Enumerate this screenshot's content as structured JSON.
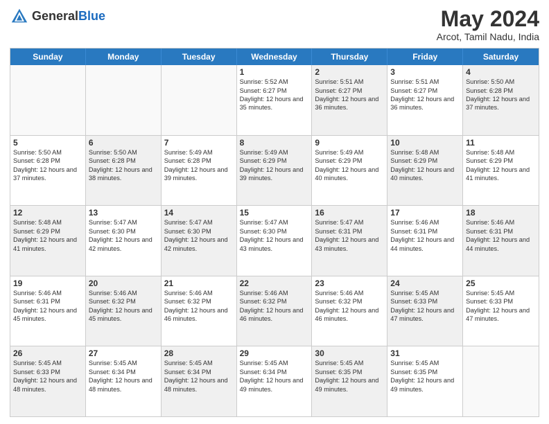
{
  "header": {
    "logo_general": "General",
    "logo_blue": "Blue",
    "month_title": "May 2024",
    "location": "Arcot, Tamil Nadu, India"
  },
  "weekdays": [
    "Sunday",
    "Monday",
    "Tuesday",
    "Wednesday",
    "Thursday",
    "Friday",
    "Saturday"
  ],
  "rows": [
    [
      {
        "day": "",
        "sunrise": "",
        "sunset": "",
        "daylight": "",
        "shaded": false,
        "empty": true
      },
      {
        "day": "",
        "sunrise": "",
        "sunset": "",
        "daylight": "",
        "shaded": false,
        "empty": true
      },
      {
        "day": "",
        "sunrise": "",
        "sunset": "",
        "daylight": "",
        "shaded": false,
        "empty": true
      },
      {
        "day": "1",
        "sunrise": "Sunrise: 5:52 AM",
        "sunset": "Sunset: 6:27 PM",
        "daylight": "Daylight: 12 hours and 35 minutes.",
        "shaded": false,
        "empty": false
      },
      {
        "day": "2",
        "sunrise": "Sunrise: 5:51 AM",
        "sunset": "Sunset: 6:27 PM",
        "daylight": "Daylight: 12 hours and 36 minutes.",
        "shaded": true,
        "empty": false
      },
      {
        "day": "3",
        "sunrise": "Sunrise: 5:51 AM",
        "sunset": "Sunset: 6:27 PM",
        "daylight": "Daylight: 12 hours and 36 minutes.",
        "shaded": false,
        "empty": false
      },
      {
        "day": "4",
        "sunrise": "Sunrise: 5:50 AM",
        "sunset": "Sunset: 6:28 PM",
        "daylight": "Daylight: 12 hours and 37 minutes.",
        "shaded": true,
        "empty": false
      }
    ],
    [
      {
        "day": "5",
        "sunrise": "Sunrise: 5:50 AM",
        "sunset": "Sunset: 6:28 PM",
        "daylight": "Daylight: 12 hours and 37 minutes.",
        "shaded": false,
        "empty": false
      },
      {
        "day": "6",
        "sunrise": "Sunrise: 5:50 AM",
        "sunset": "Sunset: 6:28 PM",
        "daylight": "Daylight: 12 hours and 38 minutes.",
        "shaded": true,
        "empty": false
      },
      {
        "day": "7",
        "sunrise": "Sunrise: 5:49 AM",
        "sunset": "Sunset: 6:28 PM",
        "daylight": "Daylight: 12 hours and 39 minutes.",
        "shaded": false,
        "empty": false
      },
      {
        "day": "8",
        "sunrise": "Sunrise: 5:49 AM",
        "sunset": "Sunset: 6:29 PM",
        "daylight": "Daylight: 12 hours and 39 minutes.",
        "shaded": true,
        "empty": false
      },
      {
        "day": "9",
        "sunrise": "Sunrise: 5:49 AM",
        "sunset": "Sunset: 6:29 PM",
        "daylight": "Daylight: 12 hours and 40 minutes.",
        "shaded": false,
        "empty": false
      },
      {
        "day": "10",
        "sunrise": "Sunrise: 5:48 AM",
        "sunset": "Sunset: 6:29 PM",
        "daylight": "Daylight: 12 hours and 40 minutes.",
        "shaded": true,
        "empty": false
      },
      {
        "day": "11",
        "sunrise": "Sunrise: 5:48 AM",
        "sunset": "Sunset: 6:29 PM",
        "daylight": "Daylight: 12 hours and 41 minutes.",
        "shaded": false,
        "empty": false
      }
    ],
    [
      {
        "day": "12",
        "sunrise": "Sunrise: 5:48 AM",
        "sunset": "Sunset: 6:29 PM",
        "daylight": "Daylight: 12 hours and 41 minutes.",
        "shaded": true,
        "empty": false
      },
      {
        "day": "13",
        "sunrise": "Sunrise: 5:47 AM",
        "sunset": "Sunset: 6:30 PM",
        "daylight": "Daylight: 12 hours and 42 minutes.",
        "shaded": false,
        "empty": false
      },
      {
        "day": "14",
        "sunrise": "Sunrise: 5:47 AM",
        "sunset": "Sunset: 6:30 PM",
        "daylight": "Daylight: 12 hours and 42 minutes.",
        "shaded": true,
        "empty": false
      },
      {
        "day": "15",
        "sunrise": "Sunrise: 5:47 AM",
        "sunset": "Sunset: 6:30 PM",
        "daylight": "Daylight: 12 hours and 43 minutes.",
        "shaded": false,
        "empty": false
      },
      {
        "day": "16",
        "sunrise": "Sunrise: 5:47 AM",
        "sunset": "Sunset: 6:31 PM",
        "daylight": "Daylight: 12 hours and 43 minutes.",
        "shaded": true,
        "empty": false
      },
      {
        "day": "17",
        "sunrise": "Sunrise: 5:46 AM",
        "sunset": "Sunset: 6:31 PM",
        "daylight": "Daylight: 12 hours and 44 minutes.",
        "shaded": false,
        "empty": false
      },
      {
        "day": "18",
        "sunrise": "Sunrise: 5:46 AM",
        "sunset": "Sunset: 6:31 PM",
        "daylight": "Daylight: 12 hours and 44 minutes.",
        "shaded": true,
        "empty": false
      }
    ],
    [
      {
        "day": "19",
        "sunrise": "Sunrise: 5:46 AM",
        "sunset": "Sunset: 6:31 PM",
        "daylight": "Daylight: 12 hours and 45 minutes.",
        "shaded": false,
        "empty": false
      },
      {
        "day": "20",
        "sunrise": "Sunrise: 5:46 AM",
        "sunset": "Sunset: 6:32 PM",
        "daylight": "Daylight: 12 hours and 45 minutes.",
        "shaded": true,
        "empty": false
      },
      {
        "day": "21",
        "sunrise": "Sunrise: 5:46 AM",
        "sunset": "Sunset: 6:32 PM",
        "daylight": "Daylight: 12 hours and 46 minutes.",
        "shaded": false,
        "empty": false
      },
      {
        "day": "22",
        "sunrise": "Sunrise: 5:46 AM",
        "sunset": "Sunset: 6:32 PM",
        "daylight": "Daylight: 12 hours and 46 minutes.",
        "shaded": true,
        "empty": false
      },
      {
        "day": "23",
        "sunrise": "Sunrise: 5:46 AM",
        "sunset": "Sunset: 6:32 PM",
        "daylight": "Daylight: 12 hours and 46 minutes.",
        "shaded": false,
        "empty": false
      },
      {
        "day": "24",
        "sunrise": "Sunrise: 5:45 AM",
        "sunset": "Sunset: 6:33 PM",
        "daylight": "Daylight: 12 hours and 47 minutes.",
        "shaded": true,
        "empty": false
      },
      {
        "day": "25",
        "sunrise": "Sunrise: 5:45 AM",
        "sunset": "Sunset: 6:33 PM",
        "daylight": "Daylight: 12 hours and 47 minutes.",
        "shaded": false,
        "empty": false
      }
    ],
    [
      {
        "day": "26",
        "sunrise": "Sunrise: 5:45 AM",
        "sunset": "Sunset: 6:33 PM",
        "daylight": "Daylight: 12 hours and 48 minutes.",
        "shaded": true,
        "empty": false
      },
      {
        "day": "27",
        "sunrise": "Sunrise: 5:45 AM",
        "sunset": "Sunset: 6:34 PM",
        "daylight": "Daylight: 12 hours and 48 minutes.",
        "shaded": false,
        "empty": false
      },
      {
        "day": "28",
        "sunrise": "Sunrise: 5:45 AM",
        "sunset": "Sunset: 6:34 PM",
        "daylight": "Daylight: 12 hours and 48 minutes.",
        "shaded": true,
        "empty": false
      },
      {
        "day": "29",
        "sunrise": "Sunrise: 5:45 AM",
        "sunset": "Sunset: 6:34 PM",
        "daylight": "Daylight: 12 hours and 49 minutes.",
        "shaded": false,
        "empty": false
      },
      {
        "day": "30",
        "sunrise": "Sunrise: 5:45 AM",
        "sunset": "Sunset: 6:35 PM",
        "daylight": "Daylight: 12 hours and 49 minutes.",
        "shaded": true,
        "empty": false
      },
      {
        "day": "31",
        "sunrise": "Sunrise: 5:45 AM",
        "sunset": "Sunset: 6:35 PM",
        "daylight": "Daylight: 12 hours and 49 minutes.",
        "shaded": false,
        "empty": false
      },
      {
        "day": "",
        "sunrise": "",
        "sunset": "",
        "daylight": "",
        "shaded": true,
        "empty": true
      }
    ]
  ]
}
